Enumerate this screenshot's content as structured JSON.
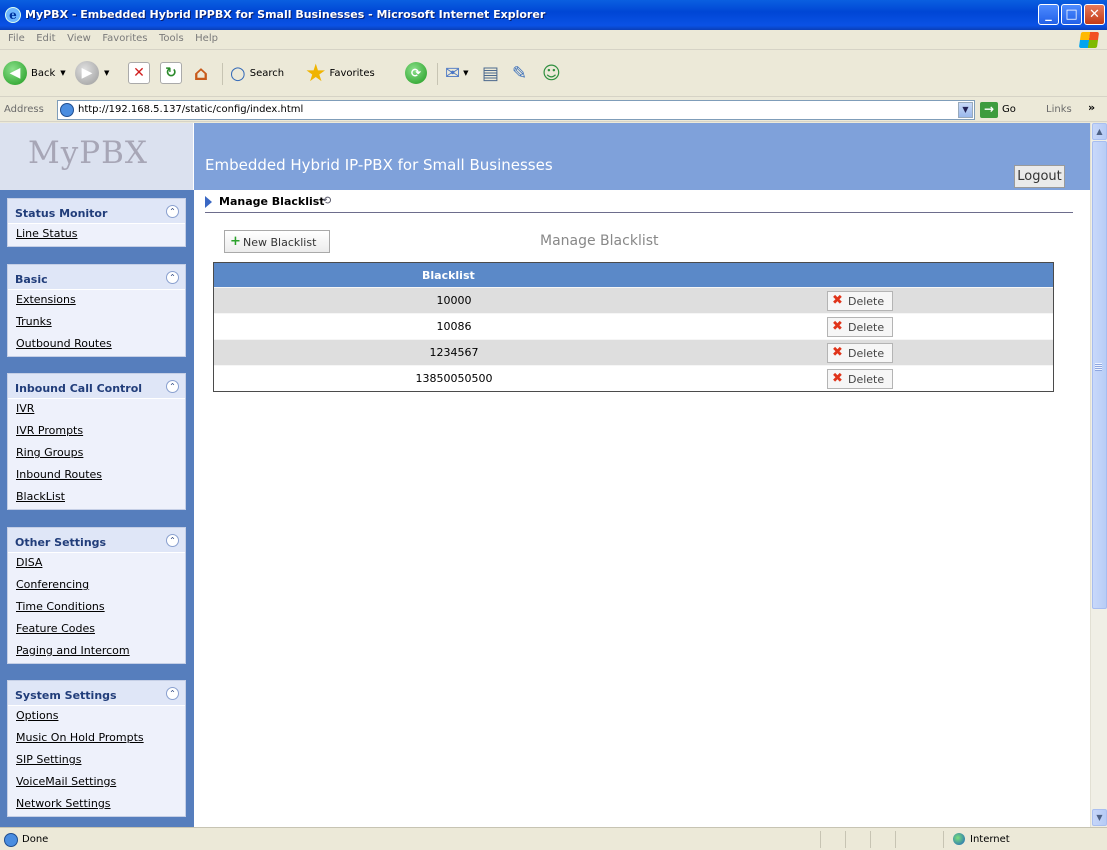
{
  "window": {
    "title": "MyPBX - Embedded Hybrid IPPBX for Small Businesses - Microsoft Internet Explorer"
  },
  "menu": [
    "File",
    "Edit",
    "View",
    "Favorites",
    "Tools",
    "Help"
  ],
  "toolbar": {
    "back": "Back",
    "search": "Search",
    "favorites": "Favorites"
  },
  "address": {
    "label": "Address",
    "url": "http://192.168.5.137/static/config/index.html",
    "go": "Go",
    "links": "Links"
  },
  "header": {
    "logo": "MyPBX",
    "subtitle": "Embedded Hybrid IP-PBX for Small Businesses",
    "logout": "Logout"
  },
  "sidebar": {
    "groups": [
      {
        "title": "Status Monitor",
        "items": [
          "Line Status"
        ]
      },
      {
        "title": "Basic",
        "items": [
          "Extensions",
          "Trunks",
          "Outbound Routes"
        ]
      },
      {
        "title": "Inbound Call Control",
        "items": [
          "IVR",
          "IVR Prompts",
          "Ring Groups",
          "Inbound Routes",
          "BlackList"
        ]
      },
      {
        "title": "Other Settings",
        "items": [
          "DISA",
          "Conferencing",
          "Time Conditions",
          "Feature Codes",
          "Paging and Intercom"
        ]
      },
      {
        "title": "System Settings",
        "items": [
          "Options",
          "Music On Hold Prompts",
          "SIP Settings",
          "VoiceMail Settings",
          "Network Settings"
        ]
      }
    ]
  },
  "content": {
    "breadcrumb": "Manage Blacklist",
    "new_button": "New Blacklist",
    "title": "Manage Blacklist",
    "column_header": "Blacklist",
    "delete_label": "Delete",
    "rows": [
      "10000",
      "10086",
      "1234567",
      "13850050500"
    ]
  },
  "status": {
    "left": "Done",
    "zone": "Internet"
  }
}
